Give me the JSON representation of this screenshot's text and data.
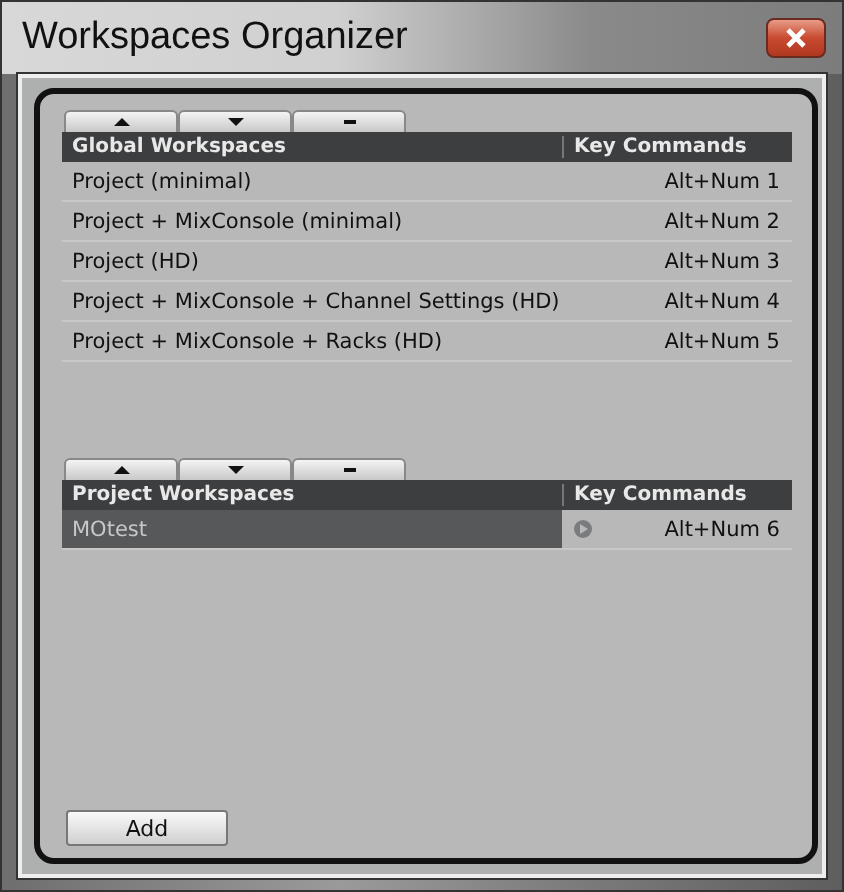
{
  "window": {
    "title": "Workspaces Organizer"
  },
  "sections": [
    {
      "columns": [
        "Global Workspaces",
        "Key Commands"
      ],
      "rows": [
        {
          "name": "Project (minimal)",
          "key": "Alt+Num 1",
          "selected": false
        },
        {
          "name": "Project + MixConsole (minimal)",
          "key": "Alt+Num 2",
          "selected": false
        },
        {
          "name": "Project (HD)",
          "key": "Alt+Num 3",
          "selected": false
        },
        {
          "name": "Project + MixConsole + Channel Settings (HD)",
          "key": "Alt+Num 4",
          "selected": false
        },
        {
          "name": "Project + MixConsole + Racks (HD)",
          "key": "Alt+Num 5",
          "selected": false
        }
      ]
    },
    {
      "columns": [
        "Project Workspaces",
        "Key Commands"
      ],
      "rows": [
        {
          "name": "MOtest",
          "key": "Alt+Num 6",
          "selected": true
        }
      ]
    }
  ],
  "buttons": [
    "Add"
  ]
}
